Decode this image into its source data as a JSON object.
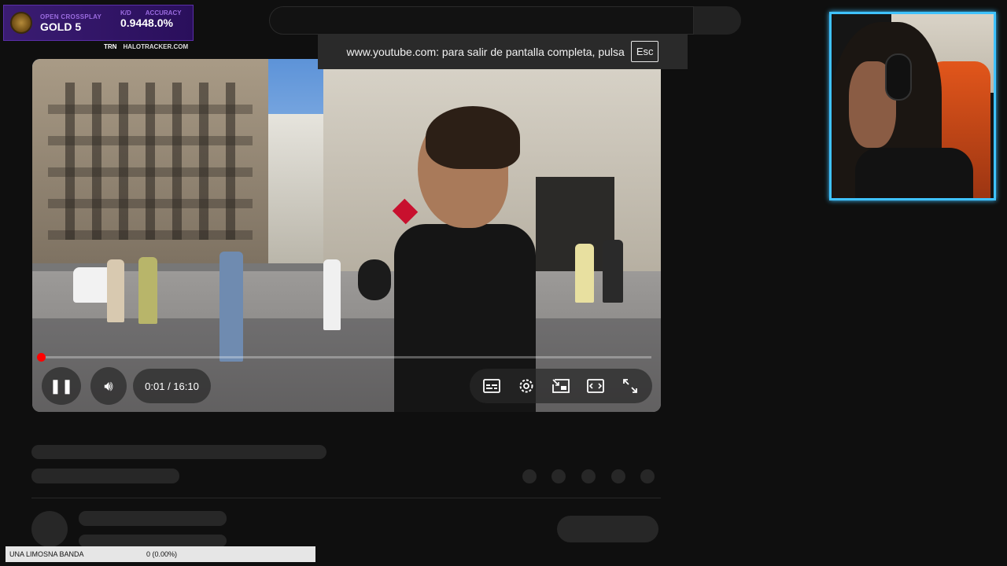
{
  "toast": {
    "message": "www.youtube.com: para salir de pantalla completa, pulsa",
    "key": "Esc"
  },
  "halo": {
    "mode_tag": "OPEN CROSSPLAY",
    "rank": "GOLD 5",
    "kd_tag": "K/D",
    "acc_tag": "ACCURACY",
    "kd_value": "0.94",
    "accuracy_value": "48.0%",
    "trn": "TRN",
    "site": "HALOTRACKER.COM"
  },
  "player": {
    "time": "0:01 / 16:10",
    "progress": 0.001,
    "icons": [
      "pause-icon",
      "volume-icon",
      "subtitles-icon",
      "settings-icon",
      "miniplayer-icon",
      "theater-icon",
      "fullscreen-exit-icon"
    ]
  },
  "banner": {
    "name": "UNA LIMOSNA BANDA",
    "value": "0 (0.00%)"
  },
  "colors": {
    "accent": "#ff0000",
    "webcam_border": "#3fc2ff",
    "halo_bg": "#3a1c72"
  }
}
